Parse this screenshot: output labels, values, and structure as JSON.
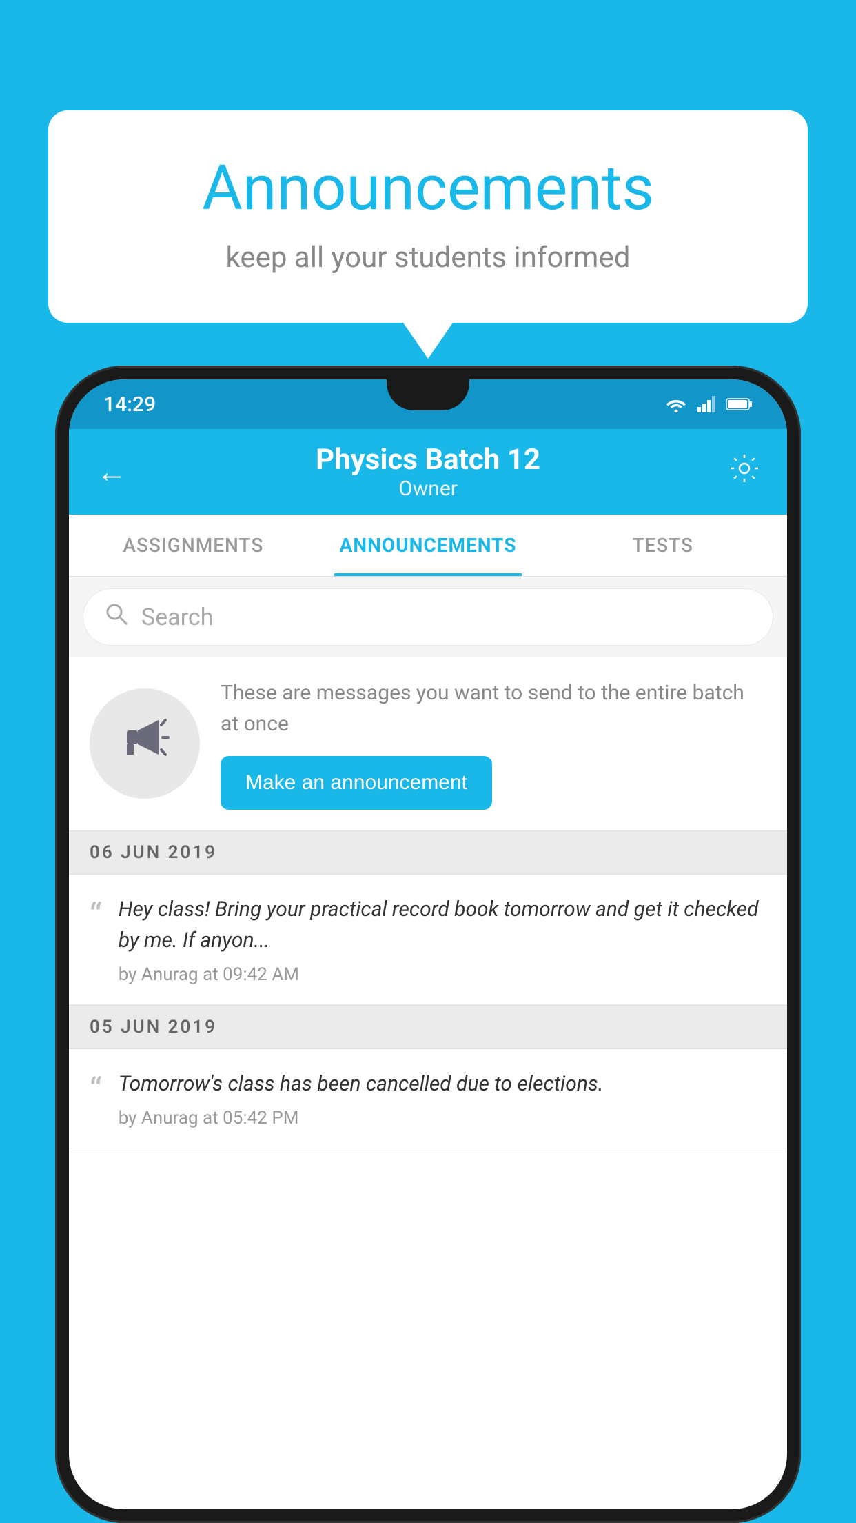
{
  "background_color": "#1ab8e8",
  "speech_bubble": {
    "title": "Announcements",
    "subtitle": "keep all your students informed"
  },
  "phone": {
    "status_bar": {
      "time": "14:29",
      "icons": [
        "wifi",
        "signal",
        "battery"
      ]
    },
    "header": {
      "title": "Physics Batch 12",
      "subtitle": "Owner",
      "back_label": "←"
    },
    "tabs": [
      {
        "label": "ASSIGNMENTS",
        "active": false
      },
      {
        "label": "ANNOUNCEMENTS",
        "active": true
      },
      {
        "label": "TESTS",
        "active": false
      }
    ],
    "search": {
      "placeholder": "Search"
    },
    "announcement_promo": {
      "description": "These are messages you want to send to the entire batch at once",
      "button_label": "Make an announcement"
    },
    "announcements": [
      {
        "date": "06  JUN  2019",
        "message": "Hey class! Bring your practical record book tomorrow and get it checked by me. If anyon...",
        "meta": "by Anurag at 09:42 AM"
      },
      {
        "date": "05  JUN  2019",
        "message": "Tomorrow's class has been cancelled due to elections.",
        "meta": "by Anurag at 05:42 PM"
      }
    ]
  }
}
